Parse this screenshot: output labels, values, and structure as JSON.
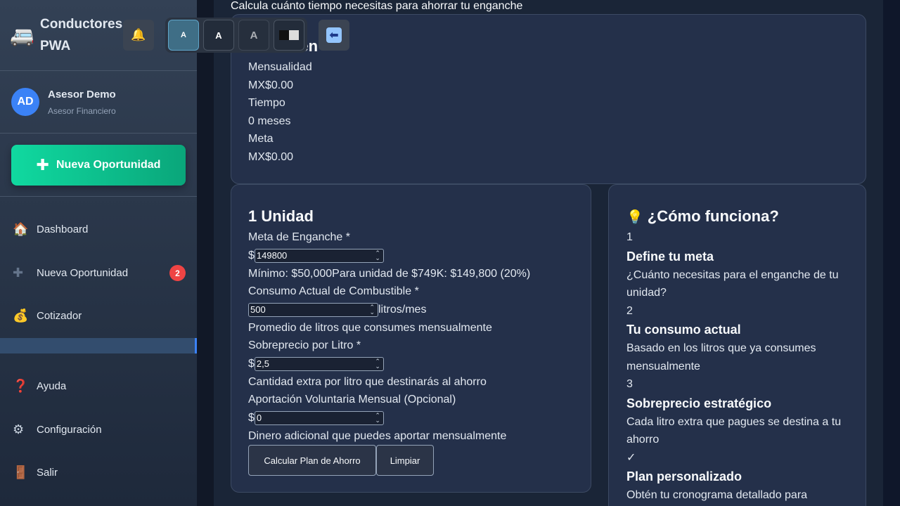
{
  "app": {
    "title": "Conductores PWA",
    "icon": "van-icon"
  },
  "user": {
    "initials": "AD",
    "name": "Asesor Demo",
    "role": "Asesor Financiero"
  },
  "sidebar": {
    "cta_label": "Nueva Oportunidad",
    "items": [
      {
        "label": "Dashboard",
        "icon": "house-icon"
      },
      {
        "label": "Nueva Oportunidad",
        "icon": "plus-icon",
        "badge": "2"
      },
      {
        "label": "Cotizador",
        "icon": "money-bag-icon"
      },
      {
        "label": "Ayuda",
        "icon": "question-icon"
      },
      {
        "label": "Configuración",
        "icon": "gear-icon"
      },
      {
        "label": "Salir",
        "icon": "door-icon"
      }
    ]
  },
  "toolbar": {
    "font_small": "A",
    "font_medium": "A",
    "font_large": "A"
  },
  "page": {
    "subtitle": "Calcula cuánto tiempo necesitas para ahorrar tu enganche"
  },
  "summary": {
    "title": "Resumen",
    "mensualidad_label": "Mensualidad",
    "mensualidad_value": "MX$0.00",
    "tiempo_label": "Tiempo",
    "tiempo_value": "0 meses",
    "meta_label": "Meta",
    "meta_value": "MX$0.00"
  },
  "form": {
    "title": "1 Unidad",
    "meta_label": "Meta de Enganche *",
    "currency": "$",
    "meta_value": "149800",
    "meta_help": "Mínimo: $50,000Para unidad de $749K: $149,800 (20%)",
    "consumo_label": "Consumo Actual de Combustible *",
    "consumo_value": "500",
    "consumo_unit": "litros/mes",
    "consumo_help": "Promedio de litros que consumes mensualmente",
    "sobreprecio_label": "Sobreprecio por Litro *",
    "sobreprecio_value": "2,5",
    "sobreprecio_help": "Cantidad extra por litro que destinarás al ahorro",
    "aportacion_label": "Aportación Voluntaria Mensual (Opcional)",
    "aportacion_value": "0",
    "aportacion_help": "Dinero adicional que puedes aportar mensualmente",
    "calc_button": "Calcular Plan de Ahorro",
    "clear_button": "Limpiar"
  },
  "howto": {
    "icon": "lightbulb-icon",
    "title": "¿Cómo funciona?",
    "steps": [
      {
        "num": "1",
        "title": "Define tu meta",
        "desc": "¿Cuánto necesitas para el enganche de tu unidad?"
      },
      {
        "num": "2",
        "title": "Tu consumo actual",
        "desc": "Basado en los litros que ya consumes mensualmente"
      },
      {
        "num": "3",
        "title": "Sobreprecio estratégico",
        "desc": "Cada litro extra que pagues se destina a tu ahorro"
      },
      {
        "num": "✓",
        "title": "Plan personalizado",
        "desc": "Obtén tu cronograma detallado para"
      }
    ]
  }
}
